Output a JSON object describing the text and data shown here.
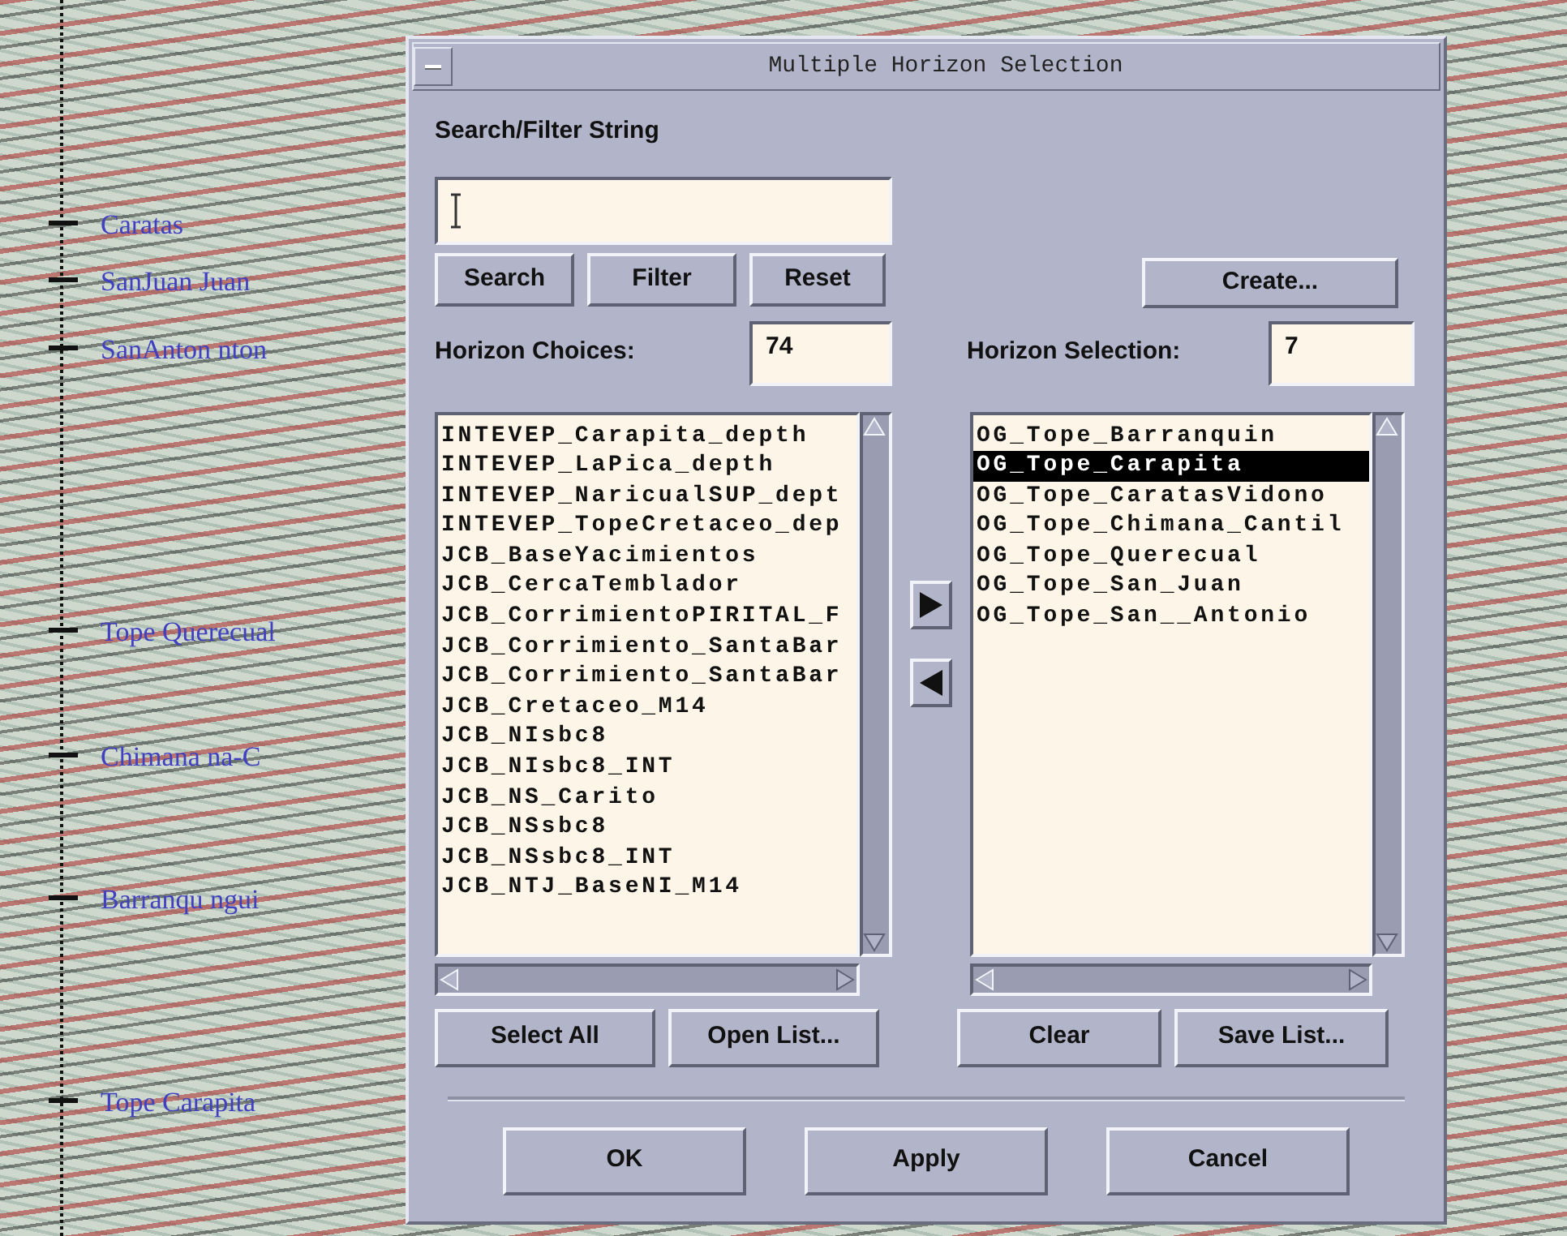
{
  "background": {
    "horizon_labels": [
      {
        "text": "Caratas"
      },
      {
        "text": "SanJuan Juan"
      },
      {
        "text": "SanAnton nton"
      },
      {
        "text": "Tope Querecual"
      },
      {
        "text": "Chimana na-C"
      },
      {
        "text": "Barranqu ngui"
      },
      {
        "text": "Tope Carapita"
      }
    ]
  },
  "dialog": {
    "title": "Multiple Horizon Selection",
    "search_label": "Search/Filter String",
    "search_buttons": [
      "Search",
      "Filter",
      "Reset"
    ],
    "create_button": "Create...",
    "choices_label": "Horizon Choices:",
    "choices_count": "74",
    "selection_label": "Horizon Selection:",
    "selection_count": "7",
    "choices": [
      {
        "text": "INTEVEP_Carapita_depth",
        "selected": false
      },
      {
        "text": "INTEVEP_LaPica_depth",
        "selected": false
      },
      {
        "text": "INTEVEP_NaricualSUP_dept",
        "selected": false
      },
      {
        "text": "INTEVEP_TopeCretaceo_dep",
        "selected": false
      },
      {
        "text": "JCB_BaseYacimientos",
        "selected": false
      },
      {
        "text": "JCB_CercaTemblador",
        "selected": false
      },
      {
        "text": "JCB_CorrimientoPIRITAL_F",
        "selected": false
      },
      {
        "text": "JCB_Corrimiento_SantaBar",
        "selected": false
      },
      {
        "text": "JCB_Corrimiento_SantaBar",
        "selected": false
      },
      {
        "text": "JCB_Cretaceo_M14",
        "selected": false
      },
      {
        "text": "JCB_NIsbc8",
        "selected": false
      },
      {
        "text": "JCB_NIsbc8_INT",
        "selected": false
      },
      {
        "text": "JCB_NS_Carito",
        "selected": false
      },
      {
        "text": "JCB_NSsbc8",
        "selected": false
      },
      {
        "text": "JCB_NSsbc8_INT",
        "selected": false
      },
      {
        "text": "JCB_NTJ_BaseNI_M14",
        "selected": false
      }
    ],
    "selection": [
      {
        "text": "OG_Tope_Barranquin",
        "selected": false
      },
      {
        "text": "OG_Tope_Carapita",
        "selected": true
      },
      {
        "text": "OG_Tope_CaratasVidono",
        "selected": false
      },
      {
        "text": "OG_Tope_Chimana_Cantil",
        "selected": false
      },
      {
        "text": "OG_Tope_Querecual",
        "selected": false
      },
      {
        "text": "OG_Tope_San_Juan",
        "selected": false
      },
      {
        "text": "OG_Tope_San__Antonio",
        "selected": false
      }
    ],
    "left_buttons": [
      "Select All",
      "Open List..."
    ],
    "right_buttons": [
      "Clear",
      "Save List..."
    ],
    "action_buttons": [
      "OK",
      "Apply",
      "Cancel"
    ]
  }
}
